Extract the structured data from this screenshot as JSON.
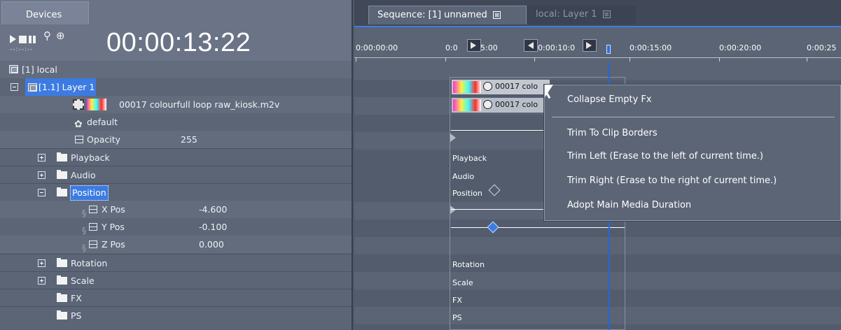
{
  "left_panel": {
    "tab_label": "Devices",
    "timecode": "00:00:13:22",
    "timecode_small": "--:--:--",
    "tree": {
      "root": "[1] local",
      "layer": "[1.1] Layer 1",
      "media": "00017 colourfull loop raw_kiosk.m2v",
      "default": "default",
      "opacity_label": "Opacity",
      "opacity_value": "255",
      "playback": "Playback",
      "audio": "Audio",
      "position": "Position",
      "x_pos_label": "X Pos",
      "x_pos_value": "-4.600",
      "y_pos_label": "Y Pos",
      "y_pos_value": "-0.100",
      "z_pos_label": "Z Pos",
      "z_pos_value": "0.000",
      "rotation": "Rotation",
      "scale": "Scale",
      "fx": "FX",
      "ps": "PS"
    }
  },
  "right_panel": {
    "tabs": [
      {
        "label": "Sequence: [1] unnamed",
        "close": "⊠"
      },
      {
        "label": "local: Layer 1",
        "close": "⊠"
      }
    ],
    "ruler_labels": [
      "0:00:00:00",
      "0:0",
      "5:00",
      "0:00:10:0",
      "0:00:15:00",
      "0:00:20:00",
      "0:00:25"
    ],
    "clips": [
      {
        "name": "00017 colo"
      },
      {
        "name": "00017 colo"
      }
    ],
    "track_labels": {
      "playback": "Playback",
      "audio": "Audio",
      "position": "Position",
      "rotation": "Rotation",
      "scale": "Scale",
      "fx": "FX",
      "ps": "PS"
    }
  },
  "context_menu": {
    "items": [
      "Collapse Empty Fx",
      "Trim To Clip Borders",
      "Trim Left (Erase to the left of current time.)",
      "Trim Right (Erase to the right of current time.)",
      "Adopt Main Media Duration"
    ]
  }
}
